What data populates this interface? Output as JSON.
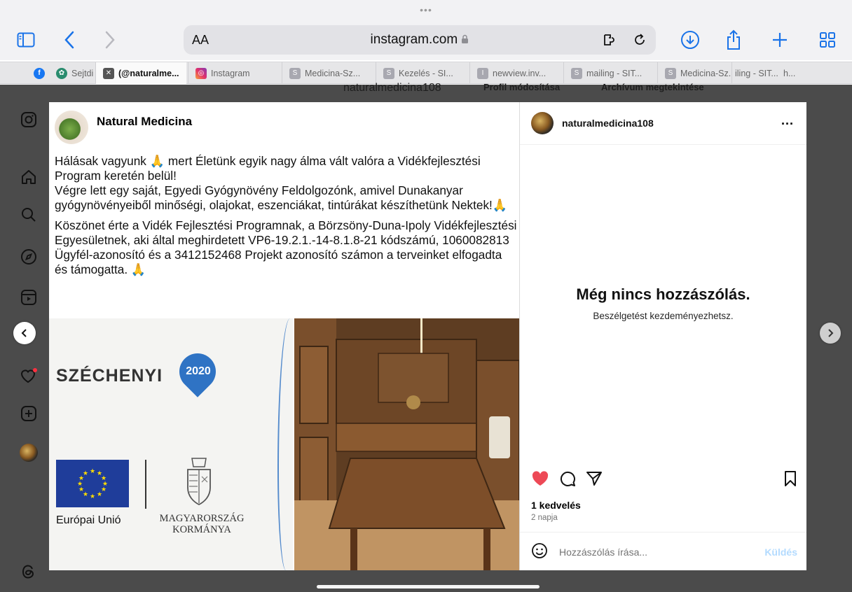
{
  "browser": {
    "dots": "•••",
    "text_size": "AA",
    "url": "instagram.com",
    "accent": "#1a73e8"
  },
  "tabs": [
    {
      "label": "Sejtdi",
      "icon": "facebook-icon"
    },
    {
      "label": "(@naturalme...",
      "icon": "x-icon"
    },
    {
      "label": "Instagram",
      "icon": "instagram-icon"
    },
    {
      "label": "Medicina-Sz...",
      "icon": "s-icon"
    },
    {
      "label": "Kezelés - SI...",
      "icon": "s-icon"
    },
    {
      "label": "newview.inv...",
      "icon": "i-icon"
    },
    {
      "label": "mailing - SIT...",
      "icon": "s-icon"
    },
    {
      "label": "Medicina-Sz...",
      "icon": "s-icon"
    },
    {
      "label": "iling - SIT...",
      "icon": "none"
    },
    {
      "label": "h...",
      "icon": "none"
    }
  ],
  "background": {
    "profile_name": "naturalmedicina108",
    "edit_profile": "Profil módosítása",
    "view_archive": "Archívum megtekintése"
  },
  "post": {
    "author": "Natural Medicina",
    "paragraphs": [
      "Hálásak vagyunk 🙏 mert Életünk egyik nagy álma vált valóra a Vidékfejlesztési Program keretén belül!",
      "Végre lett egy saját, Egyedi Gyógynövény Feldolgozónk, amivel Dunakanyar gyógynövényeiből minőségi, olajokat, eszenciákat, tintúrákat készíthetünk Nektek!🙏",
      "Köszönet érte a Vidék Fejlesztési Programnak, a Börzsöny-Duna-Ipoly Vidékfejlesztési Egyesületnek, aki által meghirdetett VP6-19.2.1.-14-8.1.8-21 kódszámú, 1060082813 Ügyfél-azonosító és a 3412152468 Projekt azonosító számon a terveinket elfogadta és támogatta. 🙏"
    ],
    "image_left": {
      "brand": "SZÉCHENYI",
      "year": "2020",
      "eu_label": "Európai Unió",
      "hu_label_1": "MAGYARORSZÁG",
      "hu_label_2": "KORMÁNYA"
    }
  },
  "panel": {
    "username": "naturalmedicina108",
    "more": "...",
    "empty_title": "Még nincs hozzászólás.",
    "empty_sub": "Beszélgetést kezdeményezhetsz.",
    "likes": "1 kedvelés",
    "age": "2 napja",
    "comment_placeholder": "Hozzászólás írása...",
    "send": "Küldés",
    "like_color": "#ed4956"
  }
}
